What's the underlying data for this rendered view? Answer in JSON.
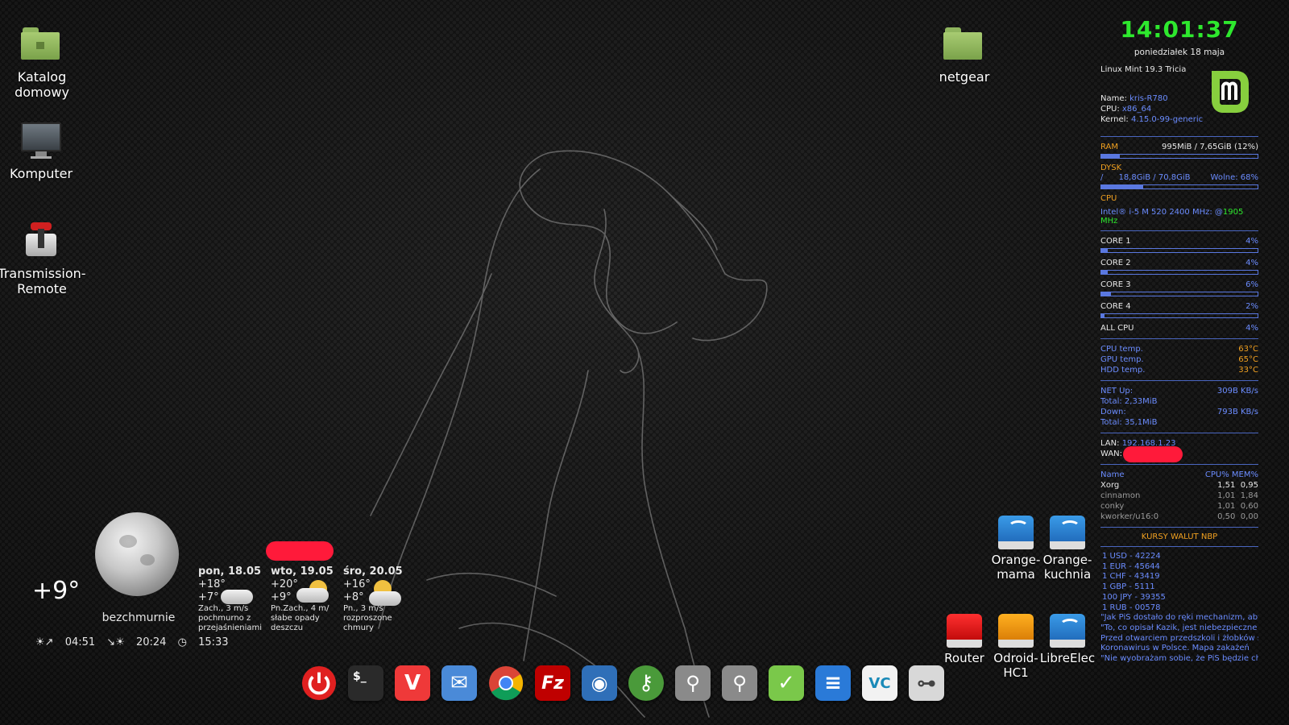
{
  "desktop": {
    "icons": [
      {
        "label": "Katalog\ndomowy",
        "line1": "Katalog",
        "line2": "domowy",
        "icon": "home-folder-icon"
      },
      {
        "label": "Komputer",
        "icon": "computer-icon"
      },
      {
        "label": "Transmission-\nRemote",
        "line1": "Transmission-",
        "line2": "Remote",
        "icon": "transmission-icon"
      },
      {
        "label": "netgear",
        "icon": "folder-icon"
      }
    ],
    "drives": [
      {
        "label": "Orange-mama",
        "icon": "network-drive-icon"
      },
      {
        "label": "Orange-\nkuchnia",
        "line1": "Orange-",
        "line2": "kuchnia",
        "icon": "network-drive-icon"
      },
      {
        "label": "Router",
        "icon": "red-drive-icon"
      },
      {
        "label": "Odroid-HC1",
        "icon": "orange-drive-icon"
      },
      {
        "label": "LibreElec",
        "icon": "network-drive-icon"
      }
    ]
  },
  "conky": {
    "time": "14:01:37",
    "date": "poniedziałek 18 maja",
    "os": "Linux Mint 19.3 Tricia",
    "name_label": "Name:",
    "name": "kris-R780",
    "cpu_label": "CPU:",
    "cpu_arch": "x86_64",
    "kernel_label": "Kernel:",
    "kernel": "4.15.0-99-generic",
    "ram_label": "RAM",
    "ram_value": "995MiB / 7,65GiB (12%)",
    "ram_pct": 12,
    "disk_label": "DYSK",
    "disk_mount": "/",
    "disk_value": "18,8GiB / 70,8GiB",
    "disk_free": "Wolne: 68%",
    "disk_pct": 27,
    "cpu_section": "CPU",
    "cpu_model": "Intel® i-5 M 520 2400 MHz: @",
    "cpu_freq": "1905 MHz",
    "cores": [
      {
        "label": "CORE 1",
        "value": "4%",
        "pct": 4
      },
      {
        "label": "CORE 2",
        "value": "4%",
        "pct": 4
      },
      {
        "label": "CORE 3",
        "value": "6%",
        "pct": 6
      },
      {
        "label": "CORE 4",
        "value": "2%",
        "pct": 2
      }
    ],
    "all_cpu_label": "ALL  CPU",
    "all_cpu_value": "4%",
    "temps": [
      {
        "label": "CPU temp.",
        "value": "63°C"
      },
      {
        "label": "GPU temp.",
        "value": "65°C"
      },
      {
        "label": "HDD temp.",
        "value": "33°C"
      }
    ],
    "net": {
      "up_label": "NET Up:",
      "up_value": "309B  KB/s",
      "up_total": "Total: 2,33MiB",
      "down_label": "Down:",
      "down_value": "793B  KB/s",
      "down_total": "Total: 35,1MiB"
    },
    "lan_label": "LAN:",
    "lan": "192.168.1.23",
    "wan_label": "WAN:",
    "proc_header": {
      "name": "Name",
      "stats": "CPU% MEM%"
    },
    "processes": [
      {
        "name": "Xorg",
        "cpu": "1,51",
        "mem": "0,95"
      },
      {
        "name": "cinnamon",
        "cpu": "1,01",
        "mem": "1,84"
      },
      {
        "name": "conky",
        "cpu": "1,01",
        "mem": "0,60"
      },
      {
        "name": "kworker/u16:0",
        "cpu": "0,50",
        "mem": "0,00"
      }
    ],
    "currency_title": "KURSY WALUT   NBP",
    "rates": [
      "1 USD - 42224",
      "1 EUR - 45644",
      "1 CHF - 43419",
      "1 GBP - 5111",
      "100 JPY - 39355",
      "1 RUB - 00578"
    ],
    "news": [
      "\"Jak PiS dostało do ręki mechanizm, aby o",
      "\"To, co opisał Kazik, jest niebezpieczne dl",
      "Przed otwarciem przedszkoli i żłobków sp",
      "Koronawirus w Polsce. Mapa zakażeń",
      "\"Nie wyobrażam sobie, że PiS będzie chcia"
    ],
    "colors": {
      "clock": "#2ee82e",
      "accent": "#6b8cff",
      "section": "#f0a020"
    }
  },
  "weather": {
    "current_temp": "+9°",
    "moon_phase": "bezchmurnie",
    "sunrise": "04:51",
    "sunset": "20:24",
    "daylight": "15:33",
    "days": [
      {
        "day": "pon, 18.05",
        "high": "+18°",
        "low": "+7°",
        "wind": "Zach., 3 m/s",
        "desc1": "pochmurno z",
        "desc2": "przejaśnieniami",
        "icon": "cloudy-icon"
      },
      {
        "day": "wto, 19.05",
        "high": "+20°",
        "low": "+9°",
        "wind": "Pn.Zach., 4 m/",
        "desc1": "słabe opady",
        "desc2": "deszczu",
        "icon": "rain-cloud-icon"
      },
      {
        "day": "śro, 20.05",
        "high": "+16°",
        "low": "+8°",
        "wind": "Pn., 3 m/s",
        "desc1": "rozproszone",
        "desc2": "chmury",
        "icon": "partly-sunny-icon"
      }
    ]
  },
  "dock": [
    {
      "name": "power-button",
      "icon": "power-icon",
      "color": "#e02020"
    },
    {
      "name": "terminal-launcher",
      "icon": "terminal-icon",
      "glyph": "$_",
      "color": "#2a2a2a"
    },
    {
      "name": "vivaldi-launcher",
      "icon": "vivaldi-icon",
      "glyph": "V",
      "color": "#ef3939"
    },
    {
      "name": "mail-launcher",
      "icon": "mail-icon",
      "glyph": "✉",
      "color": "#4a8ad8"
    },
    {
      "name": "chrome-launcher",
      "icon": "chrome-icon",
      "color": "#db4437"
    },
    {
      "name": "filezilla-launcher",
      "icon": "filezilla-icon",
      "glyph": "Fz",
      "color": "#bf0000"
    },
    {
      "name": "camera-launcher",
      "icon": "camera-icon",
      "glyph": "◉",
      "color": "#2f6fb8"
    },
    {
      "name": "keepass-launcher",
      "icon": "key-icon",
      "glyph": "⚷",
      "color": "#4a9a3a"
    },
    {
      "name": "usb-launcher-1",
      "icon": "usb-icon",
      "glyph": "⚲",
      "color": "#8a8a8a"
    },
    {
      "name": "usb-launcher-2",
      "icon": "usb-icon",
      "glyph": "⚲",
      "color": "#8a8a8a"
    },
    {
      "name": "tasks-launcher",
      "icon": "checkmark-icon",
      "glyph": "✓",
      "color": "#7ac84a"
    },
    {
      "name": "document-launcher",
      "icon": "document-icon",
      "glyph": "≡",
      "color": "#2a7ad8"
    },
    {
      "name": "veracrypt-launcher",
      "icon": "veracrypt-icon",
      "glyph": "VC",
      "color": "#f2f2f2"
    },
    {
      "name": "settings-launcher",
      "icon": "toggle-icon",
      "glyph": "⊶",
      "color": "#d8d8d8"
    }
  ]
}
